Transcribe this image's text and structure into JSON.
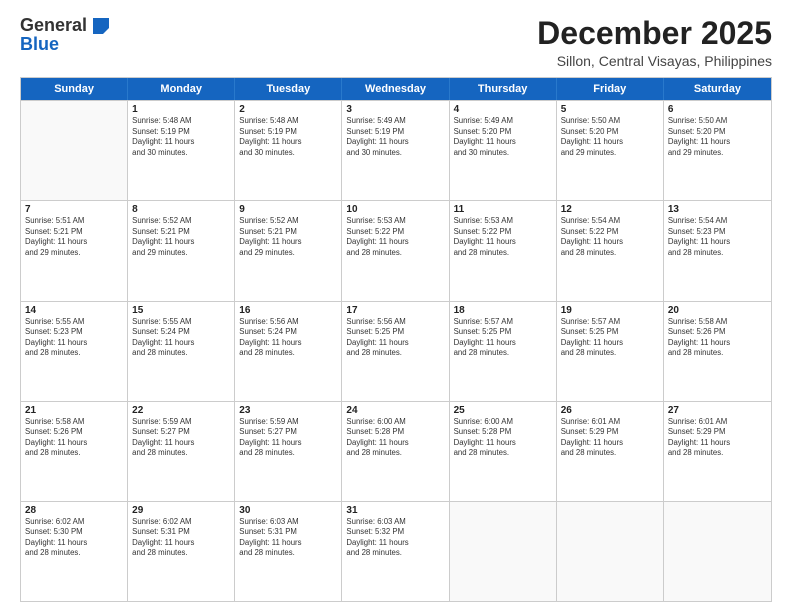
{
  "logo": {
    "general": "General",
    "blue": "Blue"
  },
  "title": "December 2025",
  "subtitle": "Sillon, Central Visayas, Philippines",
  "days": [
    "Sunday",
    "Monday",
    "Tuesday",
    "Wednesday",
    "Thursday",
    "Friday",
    "Saturday"
  ],
  "weeks": [
    [
      {
        "day": null,
        "info": null
      },
      {
        "day": "1",
        "info": "Sunrise: 5:48 AM\nSunset: 5:19 PM\nDaylight: 11 hours\nand 30 minutes."
      },
      {
        "day": "2",
        "info": "Sunrise: 5:48 AM\nSunset: 5:19 PM\nDaylight: 11 hours\nand 30 minutes."
      },
      {
        "day": "3",
        "info": "Sunrise: 5:49 AM\nSunset: 5:19 PM\nDaylight: 11 hours\nand 30 minutes."
      },
      {
        "day": "4",
        "info": "Sunrise: 5:49 AM\nSunset: 5:20 PM\nDaylight: 11 hours\nand 30 minutes."
      },
      {
        "day": "5",
        "info": "Sunrise: 5:50 AM\nSunset: 5:20 PM\nDaylight: 11 hours\nand 29 minutes."
      },
      {
        "day": "6",
        "info": "Sunrise: 5:50 AM\nSunset: 5:20 PM\nDaylight: 11 hours\nand 29 minutes."
      }
    ],
    [
      {
        "day": "7",
        "info": "Sunrise: 5:51 AM\nSunset: 5:21 PM\nDaylight: 11 hours\nand 29 minutes."
      },
      {
        "day": "8",
        "info": "Sunrise: 5:52 AM\nSunset: 5:21 PM\nDaylight: 11 hours\nand 29 minutes."
      },
      {
        "day": "9",
        "info": "Sunrise: 5:52 AM\nSunset: 5:21 PM\nDaylight: 11 hours\nand 29 minutes."
      },
      {
        "day": "10",
        "info": "Sunrise: 5:53 AM\nSunset: 5:22 PM\nDaylight: 11 hours\nand 28 minutes."
      },
      {
        "day": "11",
        "info": "Sunrise: 5:53 AM\nSunset: 5:22 PM\nDaylight: 11 hours\nand 28 minutes."
      },
      {
        "day": "12",
        "info": "Sunrise: 5:54 AM\nSunset: 5:22 PM\nDaylight: 11 hours\nand 28 minutes."
      },
      {
        "day": "13",
        "info": "Sunrise: 5:54 AM\nSunset: 5:23 PM\nDaylight: 11 hours\nand 28 minutes."
      }
    ],
    [
      {
        "day": "14",
        "info": "Sunrise: 5:55 AM\nSunset: 5:23 PM\nDaylight: 11 hours\nand 28 minutes."
      },
      {
        "day": "15",
        "info": "Sunrise: 5:55 AM\nSunset: 5:24 PM\nDaylight: 11 hours\nand 28 minutes."
      },
      {
        "day": "16",
        "info": "Sunrise: 5:56 AM\nSunset: 5:24 PM\nDaylight: 11 hours\nand 28 minutes."
      },
      {
        "day": "17",
        "info": "Sunrise: 5:56 AM\nSunset: 5:25 PM\nDaylight: 11 hours\nand 28 minutes."
      },
      {
        "day": "18",
        "info": "Sunrise: 5:57 AM\nSunset: 5:25 PM\nDaylight: 11 hours\nand 28 minutes."
      },
      {
        "day": "19",
        "info": "Sunrise: 5:57 AM\nSunset: 5:25 PM\nDaylight: 11 hours\nand 28 minutes."
      },
      {
        "day": "20",
        "info": "Sunrise: 5:58 AM\nSunset: 5:26 PM\nDaylight: 11 hours\nand 28 minutes."
      }
    ],
    [
      {
        "day": "21",
        "info": "Sunrise: 5:58 AM\nSunset: 5:26 PM\nDaylight: 11 hours\nand 28 minutes."
      },
      {
        "day": "22",
        "info": "Sunrise: 5:59 AM\nSunset: 5:27 PM\nDaylight: 11 hours\nand 28 minutes."
      },
      {
        "day": "23",
        "info": "Sunrise: 5:59 AM\nSunset: 5:27 PM\nDaylight: 11 hours\nand 28 minutes."
      },
      {
        "day": "24",
        "info": "Sunrise: 6:00 AM\nSunset: 5:28 PM\nDaylight: 11 hours\nand 28 minutes."
      },
      {
        "day": "25",
        "info": "Sunrise: 6:00 AM\nSunset: 5:28 PM\nDaylight: 11 hours\nand 28 minutes."
      },
      {
        "day": "26",
        "info": "Sunrise: 6:01 AM\nSunset: 5:29 PM\nDaylight: 11 hours\nand 28 minutes."
      },
      {
        "day": "27",
        "info": "Sunrise: 6:01 AM\nSunset: 5:29 PM\nDaylight: 11 hours\nand 28 minutes."
      }
    ],
    [
      {
        "day": "28",
        "info": "Sunrise: 6:02 AM\nSunset: 5:30 PM\nDaylight: 11 hours\nand 28 minutes."
      },
      {
        "day": "29",
        "info": "Sunrise: 6:02 AM\nSunset: 5:31 PM\nDaylight: 11 hours\nand 28 minutes."
      },
      {
        "day": "30",
        "info": "Sunrise: 6:03 AM\nSunset: 5:31 PM\nDaylight: 11 hours\nand 28 minutes."
      },
      {
        "day": "31",
        "info": "Sunrise: 6:03 AM\nSunset: 5:32 PM\nDaylight: 11 hours\nand 28 minutes."
      },
      {
        "day": null,
        "info": null
      },
      {
        "day": null,
        "info": null
      },
      {
        "day": null,
        "info": null
      }
    ]
  ]
}
